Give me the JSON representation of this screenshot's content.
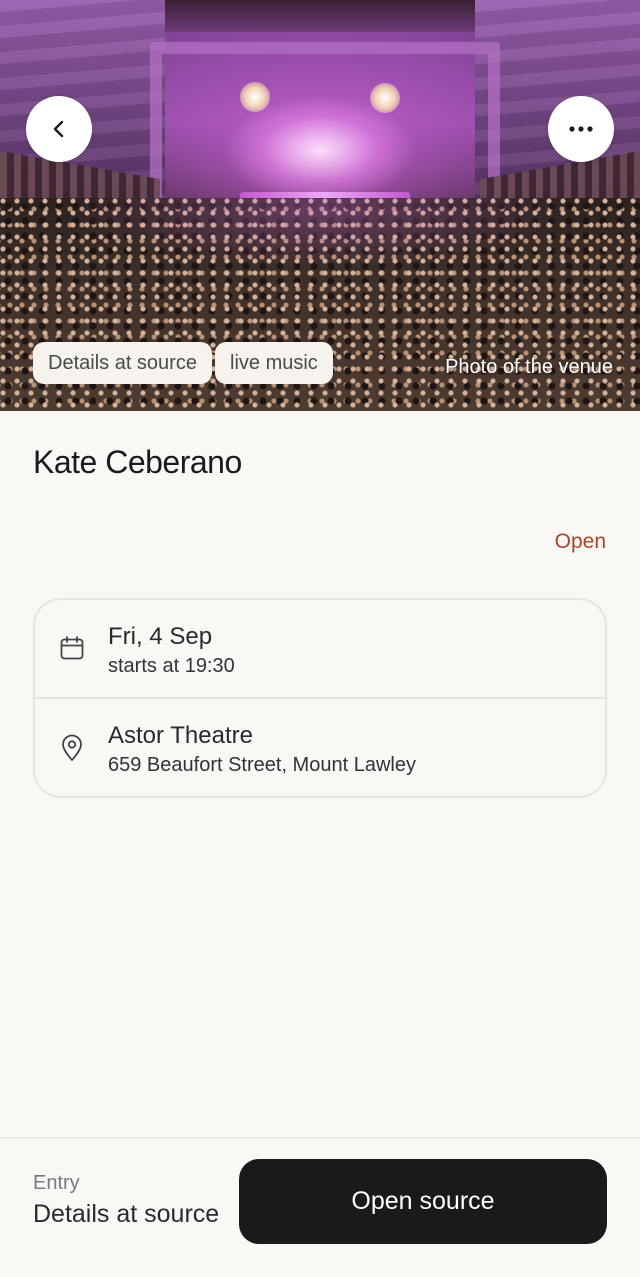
{
  "hero": {
    "caption": "Photo of the venue",
    "chips": [
      "Details at source",
      "live music"
    ],
    "back_icon": "chevron-left-icon",
    "menu_icon": "more-horizontal-icon"
  },
  "event": {
    "title": "Kate Ceberano",
    "status": "Open"
  },
  "details": {
    "date": "Fri, 4 Sep",
    "time": "starts at 19:30",
    "date_icon": "calendar-icon",
    "venue": "Astor Theatre",
    "address": "659 Beaufort Street, Mount Lawley",
    "venue_icon": "map-pin-icon"
  },
  "footer": {
    "entry_label": "Entry",
    "entry_value": "Details at source",
    "button_label": "Open source"
  },
  "colors": {
    "status": "#a5452a",
    "button_bg": "#1b1a19",
    "page_bg": "#faf8f5",
    "card_border": "#e8e5df"
  }
}
